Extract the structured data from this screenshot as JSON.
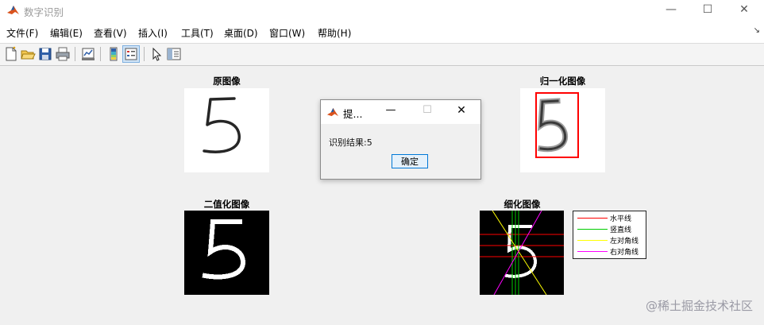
{
  "window": {
    "title": "数字识别",
    "minimize_glyph": "—",
    "maximize_glyph": "☐",
    "close_glyph": "✕"
  },
  "menu": {
    "items": [
      "文件(F)",
      "编辑(E)",
      "查看(V)",
      "插入(I)",
      "工具(T)",
      "桌面(D)",
      "窗口(W)",
      "帮助(H)"
    ],
    "overflow_glyph": "↘"
  },
  "toolbar": {
    "icons": [
      "new-figure-icon",
      "open-file-icon",
      "save-icon",
      "print-icon",
      "link-plot-icon",
      "colorbar-icon",
      "legend-icon",
      "pointer-icon",
      "property-inspector-icon"
    ]
  },
  "figure": {
    "original_title": "原图像",
    "normalized_title": "归一化图像",
    "binary_title": "二值化图像",
    "thinned_title": "细化图像",
    "legend": {
      "entries": [
        {
          "label": "水平线",
          "color": "#ff0000"
        },
        {
          "label": "竖直线",
          "color": "#00cc00"
        },
        {
          "label": "左对角线",
          "color": "#ffff00"
        },
        {
          "label": "右对角线",
          "color": "#ff00ff"
        }
      ]
    },
    "bbox_color": "#ff0000"
  },
  "dialog": {
    "title": "提...",
    "message": "识别结果:5",
    "ok_label": "确定"
  },
  "watermark": "@稀土掘金技术社区"
}
